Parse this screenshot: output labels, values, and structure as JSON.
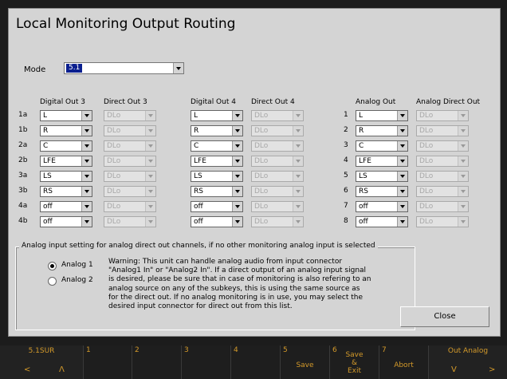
{
  "title": "Local Monitoring Output Routing",
  "mode": {
    "label": "Mode",
    "value": "5.1"
  },
  "columns": [
    {
      "key": "d3",
      "header": "Digital Out 3",
      "labels": [
        "1a",
        "1b",
        "2a",
        "2b",
        "3a",
        "3b",
        "4a",
        "4b"
      ],
      "values": [
        "L",
        "R",
        "C",
        "LFE",
        "LS",
        "RS",
        "off",
        "off"
      ],
      "disabled": false
    },
    {
      "key": "dd3",
      "header": "Direct Out 3",
      "values": [
        "DLo",
        "DLo",
        "DLo",
        "DLo",
        "DLo",
        "DLo",
        "DLo",
        "DLo"
      ],
      "disabled": true
    },
    {
      "key": "d4",
      "header": "Digital Out 4",
      "values": [
        "L",
        "R",
        "C",
        "LFE",
        "LS",
        "RS",
        "off",
        "off"
      ],
      "disabled": false
    },
    {
      "key": "dd4",
      "header": "Direct Out 4",
      "values": [
        "DLo",
        "DLo",
        "DLo",
        "DLo",
        "DLo",
        "DLo",
        "DLo",
        "DLo"
      ],
      "disabled": true
    },
    {
      "key": "ao",
      "header": "Analog Out",
      "labels": [
        "1",
        "2",
        "3",
        "4",
        "5",
        "6",
        "7",
        "8"
      ],
      "values": [
        "L",
        "R",
        "C",
        "LFE",
        "LS",
        "RS",
        "off",
        "off"
      ],
      "disabled": false
    },
    {
      "key": "ado",
      "header": "Analog Direct Out",
      "values": [
        "DLo",
        "DLo",
        "DLo",
        "DLo",
        "DLo",
        "DLo",
        "DLo",
        "DLo"
      ],
      "disabled": true
    }
  ],
  "analog_group": {
    "title": "Analog input setting for analog direct out channels, if no other monitoring analog input is selected",
    "options": [
      {
        "label": "Analog 1",
        "selected": true
      },
      {
        "label": "Analog 2",
        "selected": false
      }
    ],
    "warning": "Warning: This unit can handle analog audio from input connector \"Analog1 In\" or \"Analog2 In\". If a direct output of an analog input signal is desired, please be sure that in case of monitoring is also refering to an analog source on any of the subkeys, this is using the same source as for the direct out. If no analog monitoring is in use, you may select the desired input connector for direct out from this list."
  },
  "close_label": "Close",
  "function_keys": {
    "f0": {
      "caption": "5.1SUR",
      "left": "<",
      "right": "Λ"
    },
    "f1": {
      "num": "1"
    },
    "f2": {
      "num": "2"
    },
    "f3": {
      "num": "3"
    },
    "f4": {
      "num": "4"
    },
    "f5": {
      "num": "5",
      "label": "Save"
    },
    "f6": {
      "num": "6",
      "label": "Save\n&\nExit"
    },
    "f7": {
      "num": "7",
      "label": "Abort"
    },
    "f8": {
      "caption": "Out Analog",
      "left": "V",
      "right": ">"
    }
  },
  "colors": {
    "panel": "#d4d4d4",
    "selection": "#0a1f8f",
    "softkey_text": "#d49a2a",
    "softkey_bar": "#1e1e1e"
  }
}
